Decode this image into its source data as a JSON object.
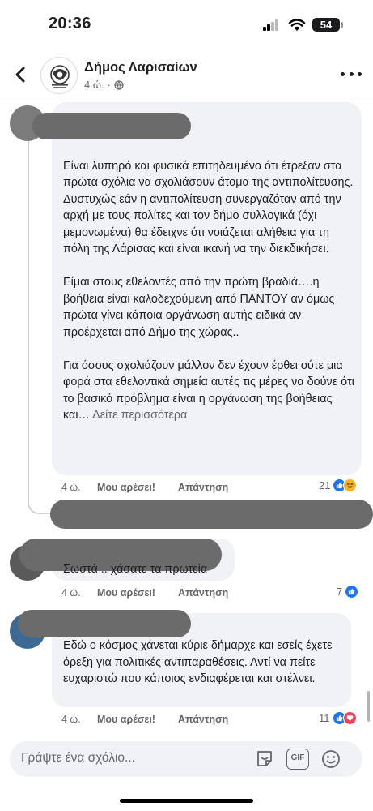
{
  "status_bar": {
    "time": "20:36",
    "battery": "54"
  },
  "header": {
    "page_name": "Δήμος Λαρισαίων",
    "time": "4 ώ.",
    "back_icon": "chevron-left-icon",
    "more_icon": "more-horizontal-icon"
  },
  "comments": [
    {
      "text": "Είναι λυπηρό και φυσικά επιτηδευμένο ότι έτρεξαν στα πρώτα σχόλια να σχολιάσουν άτομα της αντιπολίτευσης.\nΔυστυχώς εάν η αντιπολίτευση συνεργαζόταν από την αρχή με τους πολίτες και τον δήμο συλλογικά (όχι μεμονωμένα) θα έδειχνε ότι νοιάζεται αλήθεια για τη πόλη της Λάρισας και είναι ικανή να την διεκδικήσει.\n\nΕίμαι στους εθελοντές από την πρώτη βραδιά….η βοήθεια είναι καλοδεχούμενη από ΠΑΝΤΟΥ αν όμως πρώτα γίνει κάποια οργάνωση αυτής ειδικά αν προέρχεται από Δήμο της χώρας..\n\nΓια όσους σχολιάζουν μάλλον δεν έχουν έρθει ούτε μια φορά στα εθελοντικά σημεία αυτές τις μέρες να δούνε ότι το βασικό πρόβλημα είναι η οργάνωση της βοήθειας και…",
      "see_more": "Δείτε περισσότερα",
      "time": "4 ώ.",
      "like": "Μου αρέσει!",
      "reply": "Απάντηση",
      "reaction_count": "21"
    },
    {
      "text": "Σωστά .. χάσατε τα πρωτεία",
      "time": "4 ώ.",
      "like": "Μου αρέσει!",
      "reply": "Απάντηση",
      "reaction_count": "7"
    },
    {
      "text": "Εδώ ο κόσμος χάνεται κύριε δήμαρχε και εσείς έχετε όρεξη για πολιτικές αντιπαραθέσεις. Αντί να πείτε ευχαριστώ που κάποιος ενδιαφέρεται και στέλνει.",
      "time": "4 ώ.",
      "like": "Μου αρέσει!",
      "reply": "Απάντηση",
      "reaction_count": "11"
    }
  ],
  "composer": {
    "placeholder": "Γράψτε ένα σχόλιο...",
    "gif_label": "GIF"
  },
  "colors": {
    "like_blue": "#1877f2",
    "love_red": "#f33e58",
    "haha_yellow": "#f7b125",
    "bubble_bg": "#f0f2f5",
    "redaction": "#6b6b6b"
  }
}
